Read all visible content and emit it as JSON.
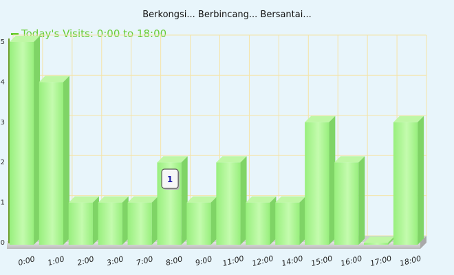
{
  "chart_data": {
    "type": "bar",
    "title": "Berkongsi... Berbincang... Bersantai...",
    "legend": {
      "label": "Today's Visits: 0:00 to 18:00",
      "placement": "top-left"
    },
    "categories": [
      "0:00",
      "1:00",
      "2:00",
      "3:00",
      "7:00",
      "8:00",
      "9:00",
      "11:00",
      "12:00",
      "14:00",
      "15:00",
      "16:00",
      "17:00",
      "18:00"
    ],
    "series": [
      {
        "name": "Today's Visits: 0:00 to 18:00",
        "values": [
          5,
          4,
          1,
          1,
          1,
          2,
          1,
          2,
          1,
          1,
          3,
          2,
          0,
          3
        ]
      }
    ],
    "yticks": [
      0,
      1,
      2,
      3,
      4,
      5
    ],
    "ylim": [
      0,
      5
    ],
    "grid": true,
    "tooltip": {
      "category": "8:00",
      "text": "1"
    },
    "colors": {
      "bar_front": "#98ef7d",
      "bar_light": "#c4fbae",
      "bar_top": "#bff7a5",
      "bar_side": "#7fd466",
      "grid": "#f5e3a6",
      "axis": "#333333",
      "legend": "#66cc33",
      "tooltip_text": "#1a1aa6"
    }
  }
}
